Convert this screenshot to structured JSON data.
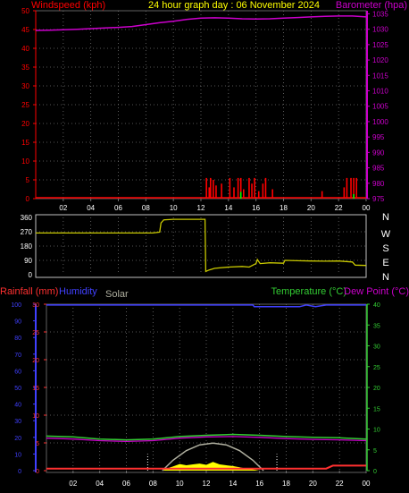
{
  "header": {
    "left_title": "Windspeed (kph)",
    "center_title": "24 hour graph day : 06 November 2024",
    "right_title": "Barometer (hpa)"
  },
  "colors": {
    "wind": "#ff0000",
    "gust": "#00ff00",
    "baro": "#cc00cc",
    "winddir": "#c8c800",
    "rain": "#ff3030",
    "humidity": "#4040ff",
    "solar": "#b0b0a0",
    "solar_fill": "#ffff00",
    "temp": "#33cc33",
    "dew": "#cc00cc",
    "grid": "#707070"
  },
  "time_ticks": [
    "02",
    "04",
    "06",
    "08",
    "10",
    "12",
    "14",
    "16",
    "18",
    "20",
    "22",
    "00"
  ],
  "chart_data": [
    {
      "type": "line",
      "name": "wind_baro",
      "title": "24 hour graph day : 06 November 2024",
      "left_axis": {
        "label": "Windspeed (kph)",
        "ticks": [
          "0",
          "5",
          "10",
          "15",
          "20",
          "25",
          "30",
          "35",
          "40",
          "45",
          "50"
        ],
        "ylim": [
          0,
          50
        ]
      },
      "right_axis": {
        "label": "Barometer (hpa)",
        "ticks": [
          "975",
          "980",
          "985",
          "990",
          "995",
          "1000",
          "1005",
          "1010",
          "1015",
          "1020",
          "1025",
          "1030",
          "1035"
        ],
        "ylim": [
          975,
          1036
        ]
      },
      "x_hours": [
        0,
        24
      ],
      "series": [
        {
          "name": "Barometer (hpa)",
          "axis": "right",
          "points": [
            [
              0,
              1029.6
            ],
            [
              1,
              1029.7
            ],
            [
              2,
              1029.8
            ],
            [
              3,
              1030.0
            ],
            [
              4,
              1030.2
            ],
            [
              5,
              1030.4
            ],
            [
              6,
              1030.6
            ],
            [
              7,
              1030.9
            ],
            [
              8,
              1031.5
            ],
            [
              9,
              1032.1
            ],
            [
              10,
              1032.6
            ],
            [
              11,
              1033.2
            ],
            [
              12,
              1033.6
            ],
            [
              13,
              1033.7
            ],
            [
              14,
              1033.6
            ],
            [
              15,
              1033.4
            ],
            [
              16,
              1033.3
            ],
            [
              17,
              1033.4
            ],
            [
              18,
              1033.6
            ],
            [
              19,
              1033.8
            ],
            [
              20,
              1034.0
            ],
            [
              21,
              1034.2
            ],
            [
              22,
              1034.3
            ],
            [
              23,
              1034.3
            ],
            [
              24,
              1034.0
            ]
          ]
        },
        {
          "name": "Wind speed",
          "axis": "left",
          "kind": "bars",
          "points": [
            [
              12.4,
              5.5
            ],
            [
              12.6,
              3.0
            ],
            [
              12.7,
              5.5
            ],
            [
              12.9,
              5.0
            ],
            [
              13.1,
              3.5
            ],
            [
              13.5,
              4.0
            ],
            [
              14.1,
              5.5
            ],
            [
              14.4,
              3.0
            ],
            [
              14.7,
              5.5
            ],
            [
              14.9,
              5.5
            ],
            [
              15.1,
              2.5
            ],
            [
              15.5,
              5.5
            ],
            [
              15.7,
              4.0
            ],
            [
              15.9,
              5.5
            ],
            [
              16.2,
              2.0
            ],
            [
              16.5,
              4.0
            ],
            [
              16.7,
              5.5
            ],
            [
              17.2,
              2.5
            ],
            [
              20.8,
              2.0
            ],
            [
              22.4,
              3.0
            ],
            [
              22.6,
              5.5
            ],
            [
              22.9,
              5.5
            ],
            [
              23.1,
              5.5
            ],
            [
              23.3,
              5.5
            ]
          ]
        },
        {
          "name": "Gust",
          "axis": "left",
          "kind": "bars",
          "points": [
            [
              14.9,
              1.8
            ],
            [
              23.1,
              1.2
            ]
          ]
        }
      ]
    },
    {
      "type": "line",
      "name": "wind_direction",
      "left_axis": {
        "ticks": [
          "0",
          "90",
          "180",
          "270",
          "360"
        ],
        "ylim": [
          0,
          360
        ]
      },
      "right_axis": {
        "ticks": [
          "N",
          "W",
          "S",
          "E",
          "N"
        ]
      },
      "series": [
        {
          "name": "Wind direction",
          "points": [
            [
              0,
              262
            ],
            [
              3,
              262
            ],
            [
              6,
              262
            ],
            [
              8.5,
              262
            ],
            [
              9,
              268
            ],
            [
              9.1,
              325
            ],
            [
              9.3,
              345
            ],
            [
              10,
              348
            ],
            [
              11,
              348
            ],
            [
              12.3,
              348
            ],
            [
              12.35,
              20
            ],
            [
              12.6,
              30
            ],
            [
              13,
              40
            ],
            [
              14,
              48
            ],
            [
              15,
              52
            ],
            [
              15.5,
              48
            ],
            [
              16,
              70
            ],
            [
              16.1,
              95
            ],
            [
              16.3,
              70
            ],
            [
              17,
              75
            ],
            [
              18,
              72
            ],
            [
              18.1,
              90
            ],
            [
              19,
              88
            ],
            [
              20,
              86
            ],
            [
              21,
              85
            ],
            [
              22,
              86
            ],
            [
              23,
              80
            ],
            [
              23.2,
              60
            ],
            [
              24,
              58
            ]
          ]
        }
      ]
    },
    {
      "type": "line",
      "name": "rain_humidity_temp",
      "labels": {
        "rain": "Rainfall (mm)",
        "humidity": "Humidity",
        "solar": "Solar",
        "temp": "Temperature (°C)",
        "dew": "Dew Point (°C)"
      },
      "left_axis_humidity": {
        "ticks": [
          "0",
          "10",
          "20",
          "30",
          "40",
          "50",
          "60",
          "70",
          "80",
          "90",
          "100"
        ],
        "ylim": [
          0,
          100
        ]
      },
      "left_axis_rain": {
        "ticks": [
          "0",
          "5",
          "10",
          "15",
          "20",
          "25",
          "30"
        ],
        "ylim": [
          0,
          30
        ]
      },
      "right_axis_temp": {
        "ticks": [
          "0",
          "5",
          "10",
          "15",
          "20",
          "25",
          "30",
          "35",
          "40"
        ],
        "ylim": [
          0,
          40
        ]
      },
      "series": [
        {
          "name": "Humidity",
          "points": [
            [
              0,
              99.5
            ],
            [
              10,
              99.5
            ],
            [
              15.5,
              99.5
            ],
            [
              15.6,
              98.5
            ],
            [
              19,
              98.5
            ],
            [
              19.5,
              99.5
            ],
            [
              20.2,
              98.5
            ],
            [
              21,
              99.5
            ],
            [
              24,
              99.5
            ]
          ]
        },
        {
          "name": "Temperature",
          "points": [
            [
              0,
              8.3
            ],
            [
              2,
              8.1
            ],
            [
              4,
              7.6
            ],
            [
              6,
              7.4
            ],
            [
              8,
              7.6
            ],
            [
              10,
              8.2
            ],
            [
              12,
              8.5
            ],
            [
              14,
              8.7
            ],
            [
              16,
              8.5
            ],
            [
              18,
              8.2
            ],
            [
              20,
              8.0
            ],
            [
              22,
              7.9
            ],
            [
              24,
              7.6
            ]
          ]
        },
        {
          "name": "Dew Point",
          "points": [
            [
              0,
              7.8
            ],
            [
              2,
              7.6
            ],
            [
              4,
              7.2
            ],
            [
              6,
              7.0
            ],
            [
              8,
              7.2
            ],
            [
              10,
              7.8
            ],
            [
              12,
              8.1
            ],
            [
              14,
              8.2
            ],
            [
              16,
              8.0
            ],
            [
              18,
              7.7
            ],
            [
              20,
              7.5
            ],
            [
              22,
              7.4
            ],
            [
              24,
              7.2
            ]
          ]
        },
        {
          "name": "Solar max",
          "points": [
            [
              8.7,
              0
            ],
            [
              9.5,
              2.5
            ],
            [
              10.5,
              4.8
            ],
            [
              11.5,
              6.2
            ],
            [
              12.5,
              6.6
            ],
            [
              13.5,
              6.2
            ],
            [
              14.5,
              4.8
            ],
            [
              15.5,
              2.5
            ],
            [
              16.3,
              0
            ]
          ]
        },
        {
          "name": "Solar",
          "points": [
            [
              8.8,
              0.3
            ],
            [
              9.5,
              1.0
            ],
            [
              10,
              1.6
            ],
            [
              10.5,
              1.3
            ],
            [
              11,
              1.5
            ],
            [
              11.5,
              1.7
            ],
            [
              12,
              1.4
            ],
            [
              12.5,
              2.1
            ],
            [
              13,
              1.5
            ],
            [
              13.5,
              1.3
            ],
            [
              14,
              1.1
            ],
            [
              14.5,
              0.8
            ],
            [
              15,
              0.5
            ],
            [
              15.5,
              0.3
            ],
            [
              16,
              0
            ]
          ]
        },
        {
          "name": "Rainfall",
          "points": [
            [
              0,
              0.5
            ],
            [
              21,
              0.5
            ],
            [
              21.5,
              1.2
            ],
            [
              24,
              1.2
            ]
          ]
        }
      ],
      "markers_hours": [
        7.6,
        17.3
      ]
    }
  ]
}
